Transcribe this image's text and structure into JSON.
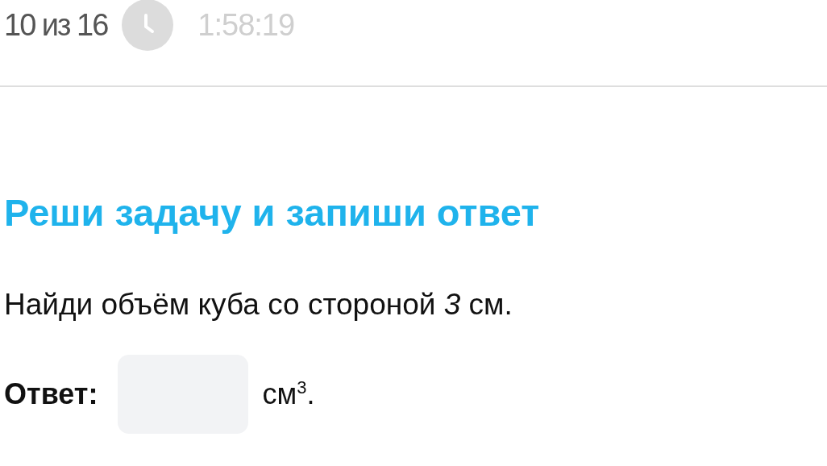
{
  "header": {
    "progress": "10 из 16",
    "timer": "1:58:19"
  },
  "task": {
    "title": "Реши задачу и запиши ответ",
    "question": "Найди объём куба со стороной *3* см.",
    "answer_label": "Ответ:",
    "unit": "см$^{3}$."
  }
}
